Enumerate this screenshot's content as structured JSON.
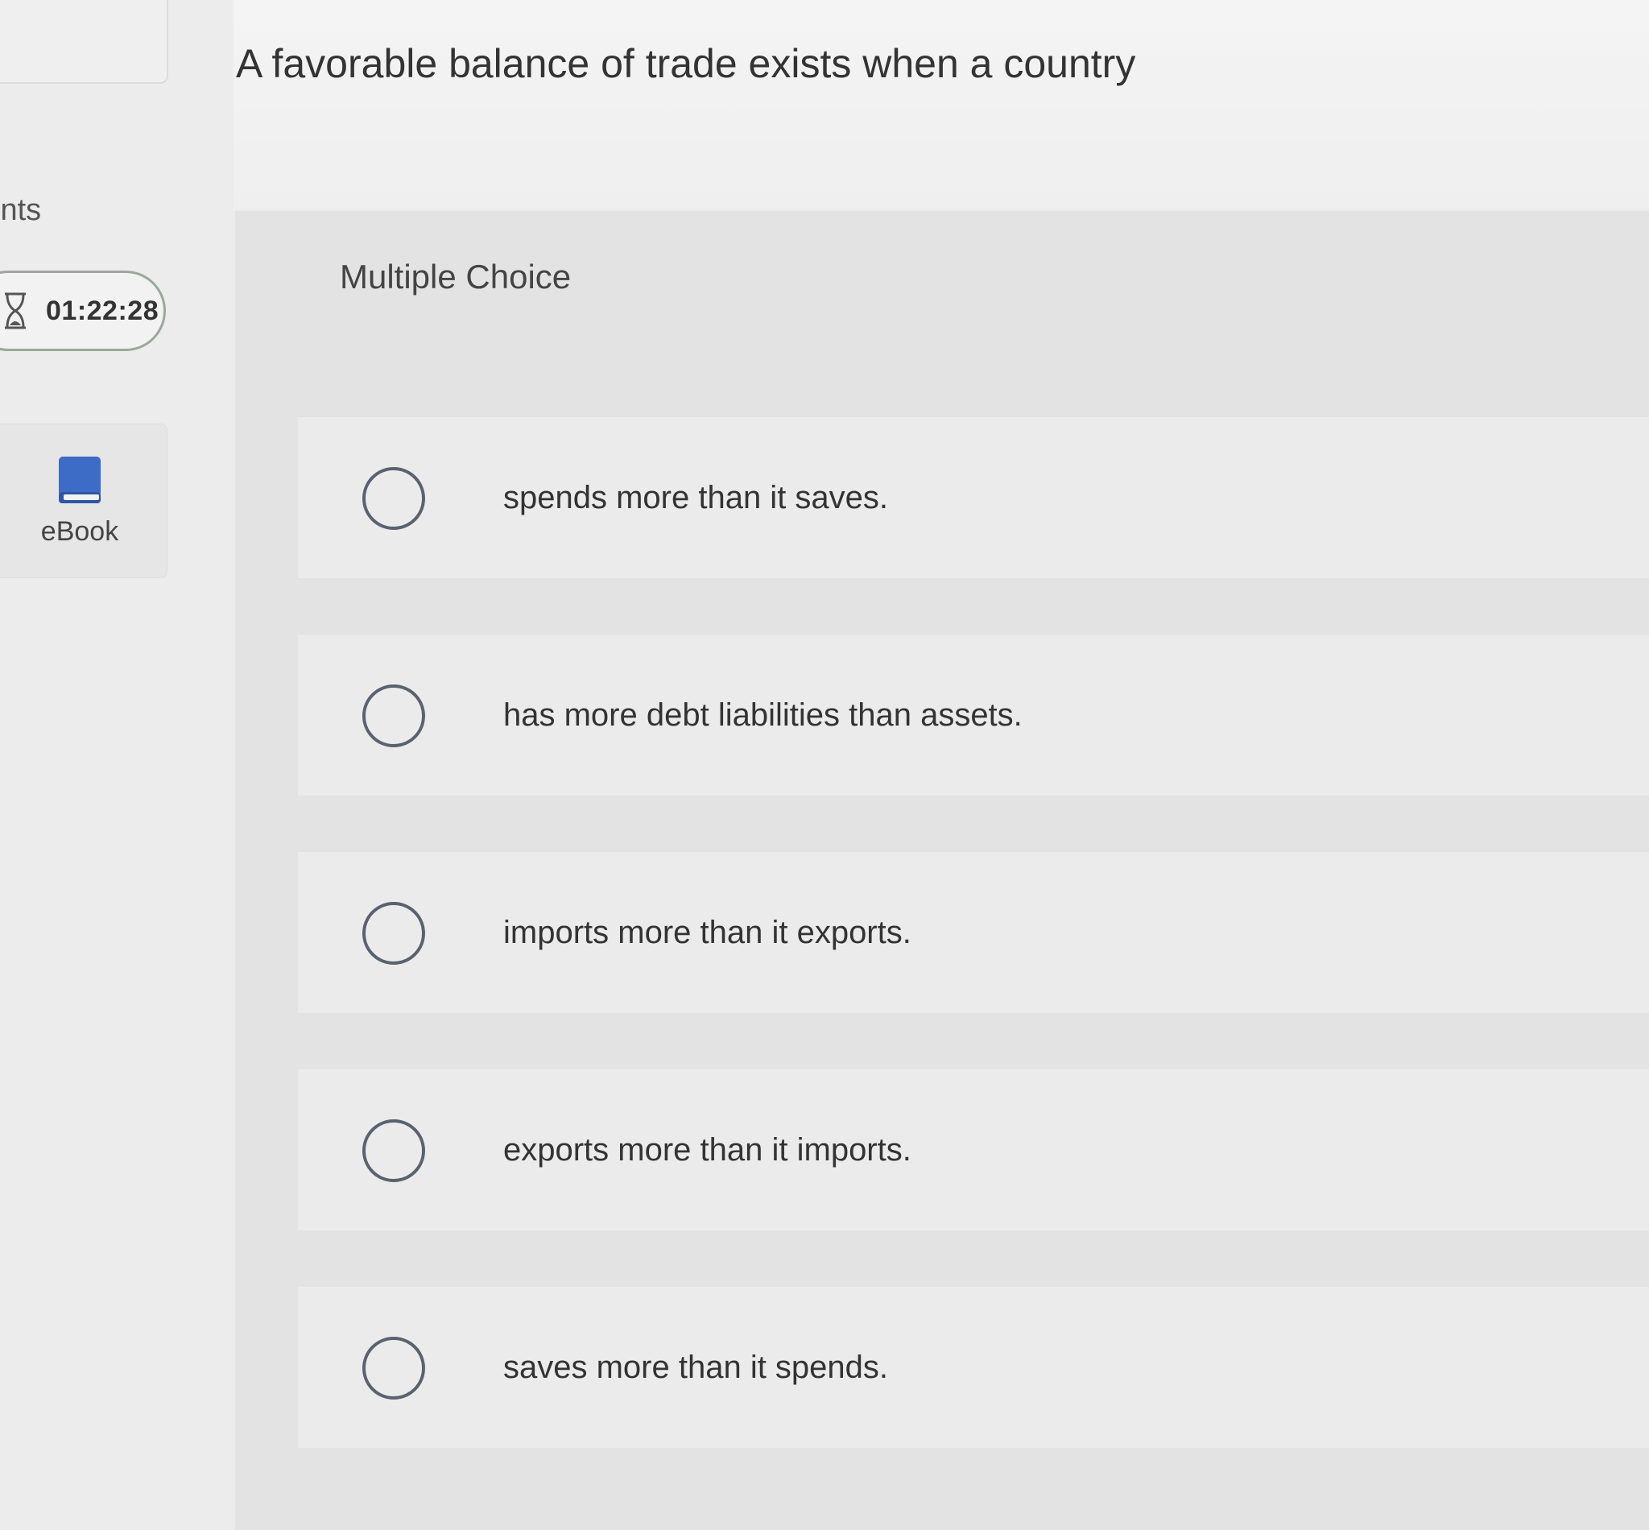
{
  "question": {
    "text": "A favorable balance of trade exists when a country"
  },
  "sidebar": {
    "points_label": "ints",
    "timer": "01:22:28",
    "ebook_label": "eBook"
  },
  "panel": {
    "type_label": "Multiple Choice"
  },
  "options": [
    {
      "label": "spends more than it saves.",
      "selected": false
    },
    {
      "label": "has more debt liabilities than assets.",
      "selected": false
    },
    {
      "label": "imports more than it exports.",
      "selected": false
    },
    {
      "label": "exports more than it imports.",
      "selected": false
    },
    {
      "label": "saves more than it spends.",
      "selected": false
    }
  ],
  "colors": {
    "radio_border": "#5a6270",
    "ebook_icon": "#3d6cc7",
    "timer_border": "#9aa89a"
  }
}
